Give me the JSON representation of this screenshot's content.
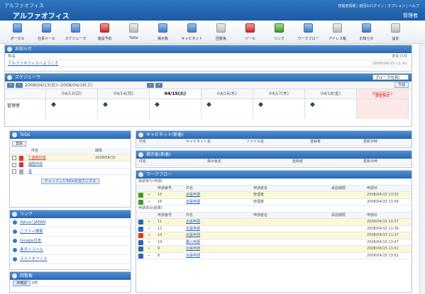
{
  "header": {
    "brand": "アルファオフィス",
    "app_title": "アルファオフィス",
    "top_links": "管理者情報 | 前回のログイン | オプション | ヘルプ",
    "user": "管理者"
  },
  "toolbar": [
    {
      "label": "ポータル",
      "icon": "portal-icon"
    },
    {
      "label": "仕事メール",
      "icon": "mail-icon"
    },
    {
      "label": "スケジューラ",
      "icon": "scheduler-icon"
    },
    {
      "label": "施設予約",
      "icon": "facility-icon"
    },
    {
      "label": "ToDo",
      "icon": "todo-icon"
    },
    {
      "label": "掲示板",
      "icon": "board-icon"
    },
    {
      "label": "キャビネット",
      "icon": "cabinet-icon"
    },
    {
      "label": "回覧板",
      "icon": "circular-icon"
    },
    {
      "label": "ツール",
      "icon": "tool-icon"
    },
    {
      "label": "リンク",
      "icon": "link-icon"
    },
    {
      "label": "ワークフロー",
      "icon": "workflow-icon"
    },
    {
      "label": "アドレス帳",
      "icon": "address-icon"
    },
    {
      "label": "お知らせ",
      "icon": "notice-icon"
    },
    {
      "label": "設定",
      "icon": "settings-icon"
    }
  ],
  "notice": {
    "title": "お知らせ",
    "head_left": "件名",
    "head_right": "更新日時",
    "item": "アルファオフィスへようこそ",
    "item_date": "2008/04/15 11:41"
  },
  "scheduler": {
    "title": "スケジューラ",
    "view_select": "グループ(社員)",
    "range": "2008/04/13(日)~2008/04/19(土)",
    "today_btn": "今週",
    "days": [
      "04/13(日)",
      "04/14(月)",
      "04/15(火)",
      "04/16(水)",
      "04/17(木)",
      "04/18(金)",
      "04/19(土)"
    ],
    "row_user": "管理者",
    "holiday_note": "振替休日"
  },
  "todo": {
    "title": "ToDo",
    "new_btn": "登録",
    "head": [
      "件名",
      "期限"
    ],
    "items": [
      {
        "title": "T 議題作成",
        "date": "2008/04/15"
      },
      {
        "title": "議題作成",
        "date": ""
      },
      {
        "title": "あ",
        "date": ""
      }
    ],
    "done_btn": "チェックしたToDoを完了にする"
  },
  "links": {
    "title": "リンク",
    "items": [
      "Yahoo! JAPAN",
      "ニフティ検索",
      "Google日本",
      "楽天トラベル",
      "ライトオフィス"
    ]
  },
  "misc": {
    "title": "回覧板",
    "status": "未確認",
    "count": "0件"
  },
  "cabinet": {
    "title": "キャビネット(新着)",
    "head": [
      "件名",
      "キャビネット名",
      "ファイル名",
      "登録者",
      "更新日時"
    ]
  },
  "board": {
    "title": "掲示板(新着)",
    "head": [
      "件名",
      "掲示板名",
      "登録者",
      "更新日時"
    ]
  },
  "workflow": {
    "title": "ワークフロー",
    "sec1": "承認待ち(申請)",
    "sec2": "申請済み(結果)",
    "head": [
      "申請番号",
      "件名",
      "申請者名",
      "承認期限",
      "申請日"
    ],
    "pending": [
      {
        "no": "15",
        "subject": "出張申請",
        "applicant": "管理者",
        "date": "2008/04/15 13:55"
      },
      {
        "no": "16",
        "subject": "出張申請",
        "applicant": "管理者",
        "date": "2008/04/15 13:56"
      }
    ],
    "done": [
      {
        "no": "11",
        "subject": "出張申請",
        "date": "2008/04/15 10:57"
      },
      {
        "no": "12",
        "subject": "出張申請",
        "date": "2008/04/15 11:36"
      },
      {
        "no": "13",
        "subject": "出張申請",
        "date": "2008/04/15 11:37"
      },
      {
        "no": "14",
        "subject": "購入申請",
        "date": "2008/04/15 13:47"
      },
      {
        "no": "9",
        "subject": "出張申請",
        "date": "2008/04/15 13:51"
      },
      {
        "no": "8",
        "subject": "出張申請",
        "date": "2008/04/15 13:52"
      }
    ]
  },
  "colors": {
    "accent": "#2a68b0",
    "highlight_row": "#fbf8d8",
    "today": "#ffffff",
    "holiday": "#fde8e8"
  }
}
